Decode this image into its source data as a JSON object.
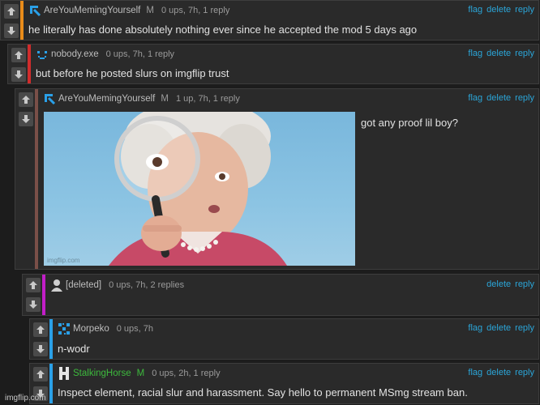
{
  "colors": {
    "link": "#2ba5d8",
    "bar_orange": "#e98c1a",
    "bar_red": "#d02c2c",
    "bar_brown": "#7a4f48",
    "bar_magenta": "#c21ec8",
    "bar_blue": "#2aa0e8",
    "mod_green": "#3dba3d"
  },
  "comments": [
    {
      "user": "AreYouMemingYourself",
      "badge": "M",
      "meta": "0 ups, 7h, 1 reply",
      "actions": [
        "flag",
        "delete",
        "reply"
      ],
      "text": "he literally has done absolutely nothing ever since he accepted the mod 5 days ago",
      "avatar_icon": "corner-arrow-icon"
    },
    {
      "user": "nobody.exe",
      "meta": "0 ups, 7h, 1 reply",
      "actions": [
        "flag",
        "delete",
        "reply"
      ],
      "text": "but before he posted slurs on imgflip trust",
      "avatar_icon": "pixel-smiley-icon"
    },
    {
      "user": "AreYouMemingYourself",
      "badge": "M",
      "meta": "1 up, 7h, 1 reply",
      "actions": [
        "flag",
        "delete",
        "reply"
      ],
      "text": "got any proof lil boy?",
      "avatar_icon": "corner-arrow-icon",
      "image_watermark": "imgflip.com"
    },
    {
      "user": "[deleted]",
      "meta": "0 ups, 7h, 2 replies",
      "actions": [
        "delete",
        "reply"
      ],
      "avatar_icon": "person-icon"
    },
    {
      "user": "Morpeko",
      "meta": "0 ups, 7h",
      "actions": [
        "flag",
        "delete",
        "reply"
      ],
      "text": "n-wodr",
      "avatar_icon": "pixel-pattern-icon"
    },
    {
      "user": "StalkingHorse",
      "badge": "M",
      "meta": "0 ups, 2h, 1 reply",
      "actions": [
        "flag",
        "delete",
        "reply"
      ],
      "text": "Inspect element, racial slur and harassment. Say hello to permanent MSmg stream ban.",
      "avatar_icon": "h-letter-icon"
    }
  ],
  "site_watermark": "imgflip.com"
}
